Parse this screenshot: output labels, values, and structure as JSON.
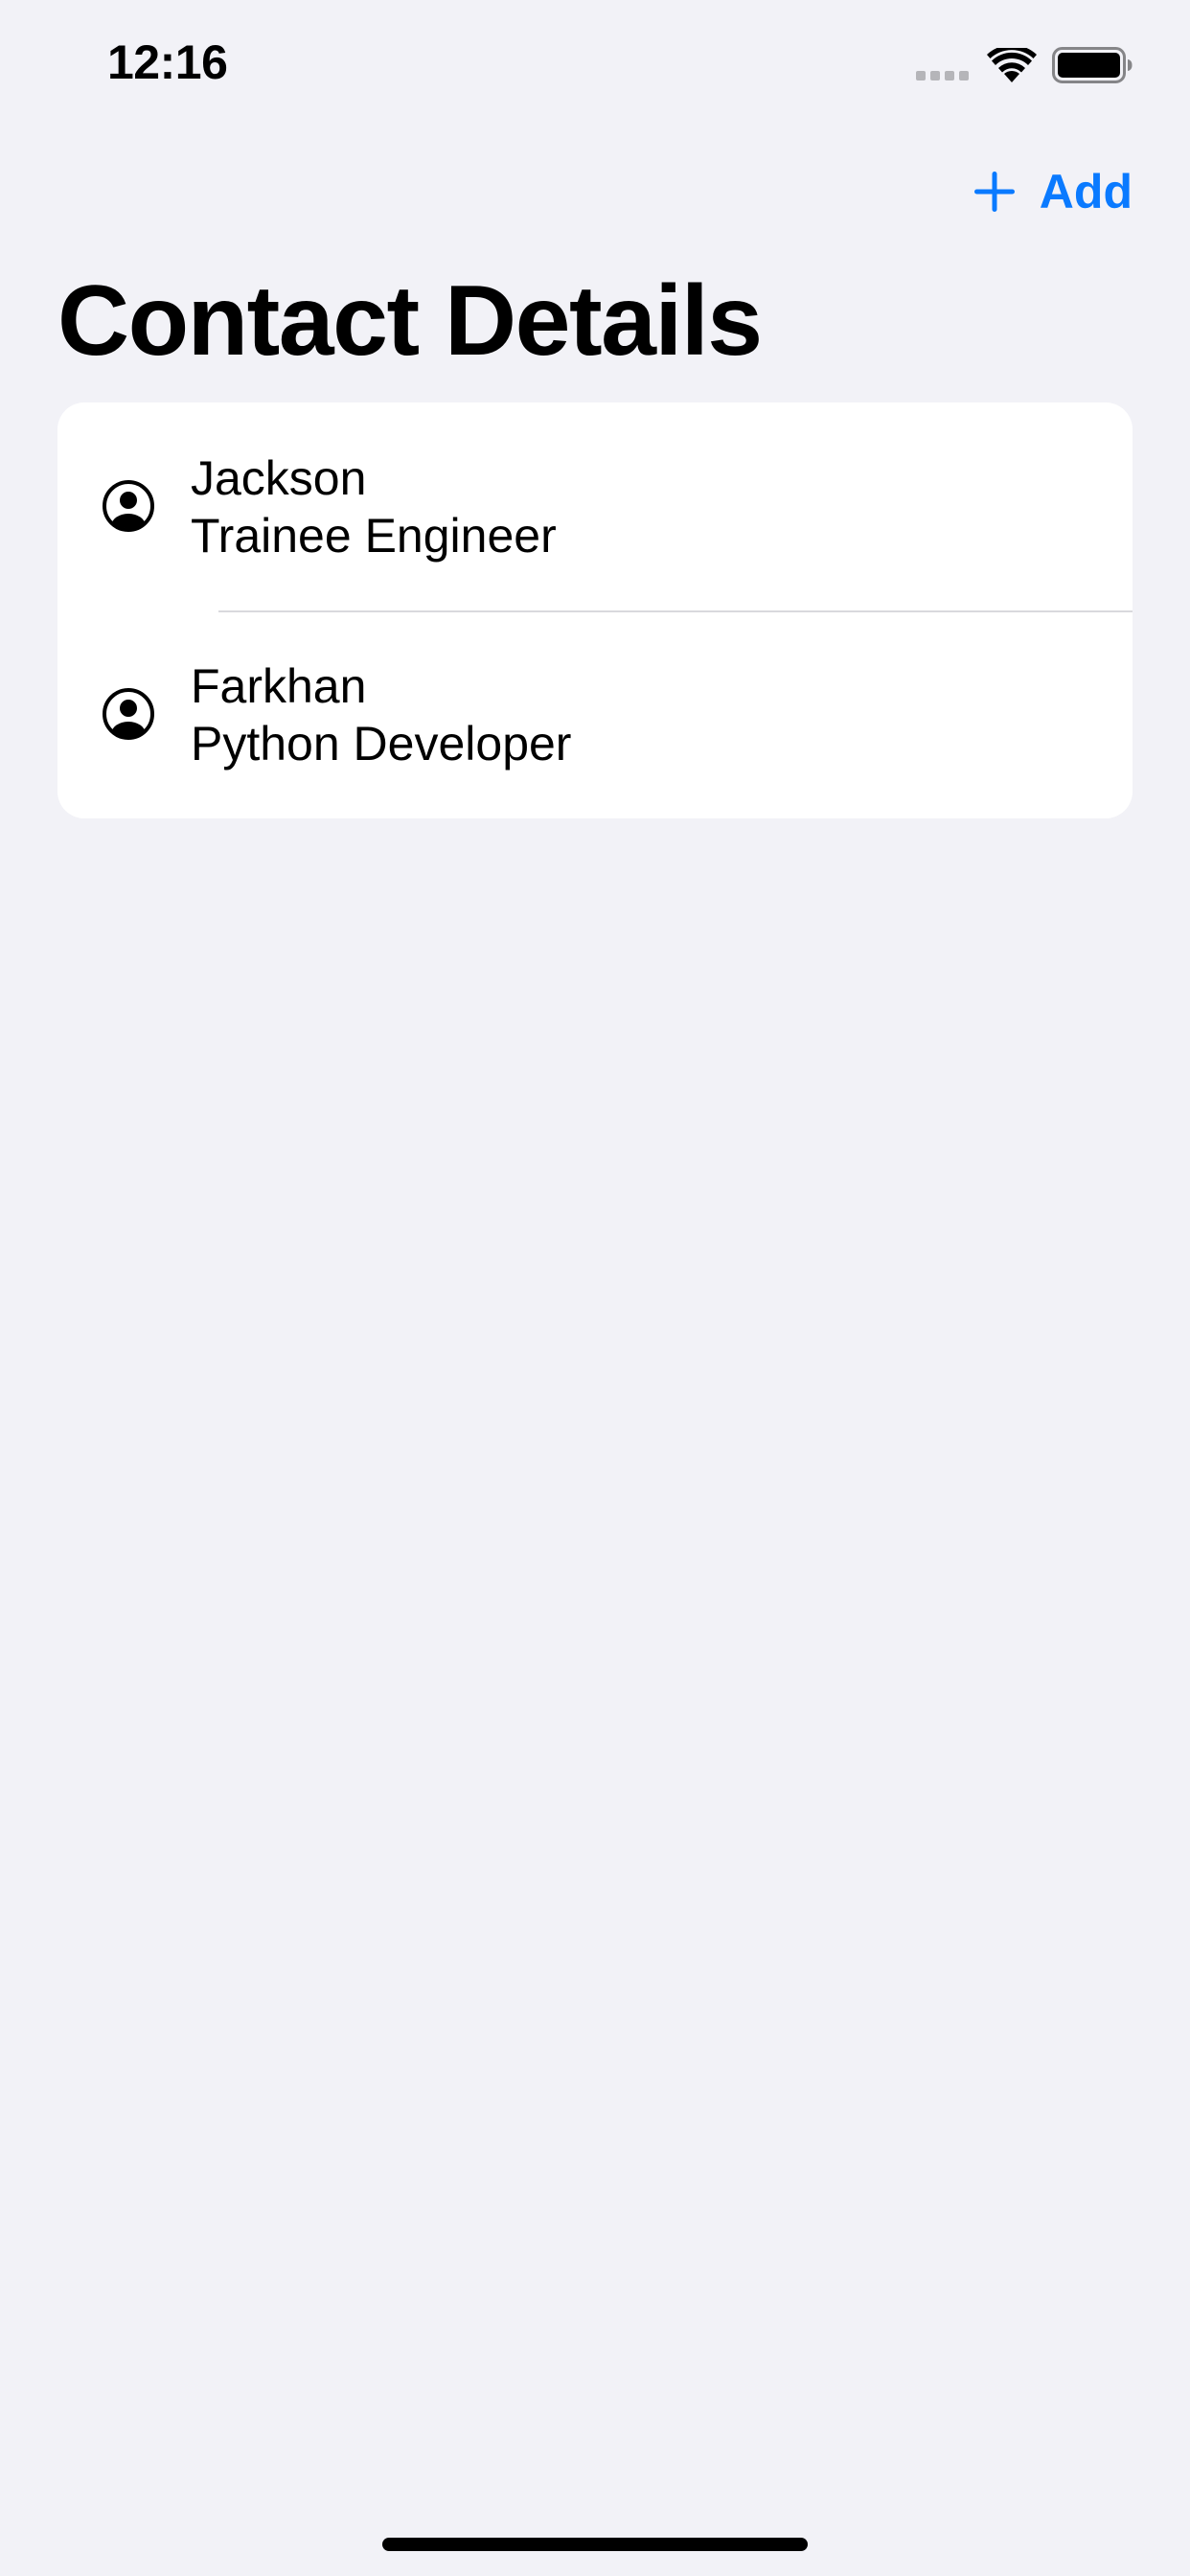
{
  "status_bar": {
    "time": "12:16"
  },
  "nav": {
    "add_label": "Add"
  },
  "page": {
    "title": "Contact Details"
  },
  "contacts": [
    {
      "name": "Jackson",
      "role": "Trainee Engineer"
    },
    {
      "name": "Farkhan",
      "role": "Python Developer"
    }
  ],
  "colors": {
    "accent": "#0a7aff",
    "background": "#f2f2f7",
    "card": "#ffffff",
    "separator": "#d9d9dd"
  },
  "icons": {
    "add": "plus-icon",
    "contact": "person-crop-circle-icon",
    "wifi": "wifi-icon",
    "battery": "battery-icon",
    "signal": "cellular-signal-icon"
  }
}
